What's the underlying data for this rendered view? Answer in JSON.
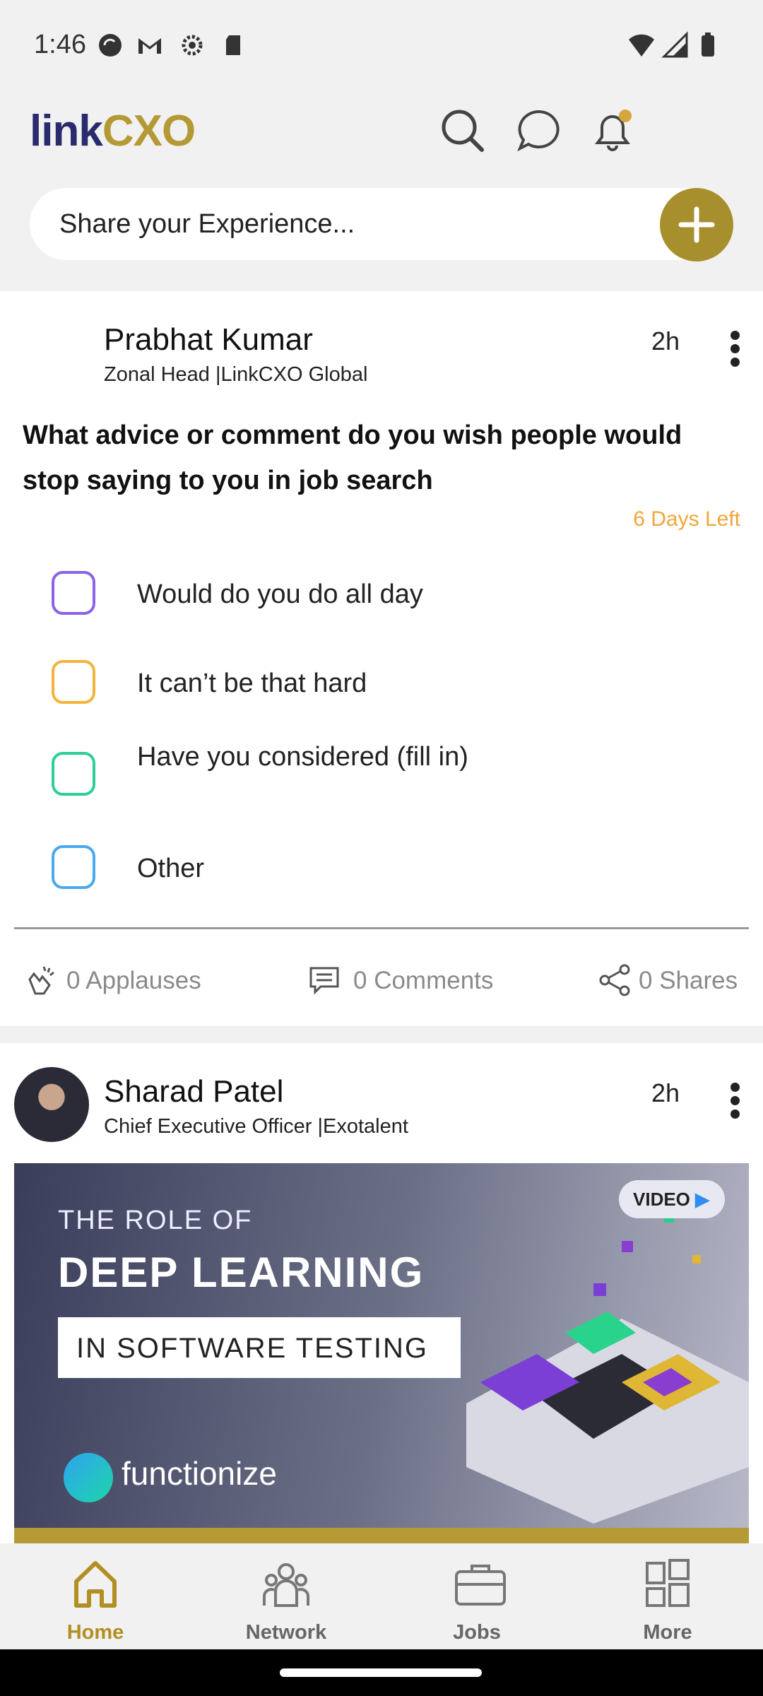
{
  "status_bar": {
    "time": "1:46"
  },
  "header": {
    "logo_part1": "link",
    "logo_part2": "CXO",
    "share_placeholder": "Share your Experience..."
  },
  "post1": {
    "author": "Prabhat Kumar",
    "subtitle": "Zonal Head |LinkCXO Global",
    "time": "2h",
    "question": "What advice or comment do you wish people would stop saying to you in job search",
    "days_left": "6 Days Left",
    "options": [
      {
        "label": "Would do you do all day",
        "color": "#8a63e8"
      },
      {
        "label": "It can’t be that hard",
        "color": "#f2b43a"
      },
      {
        "label": "Have you considered (fill in)",
        "color": "#2ecf97"
      },
      {
        "label": "Other",
        "color": "#4aa8ee"
      }
    ],
    "stats": {
      "applauses": "0 Applauses",
      "comments": "0 Comments",
      "shares": "0 Shares"
    }
  },
  "post2": {
    "author": "Sharad Patel",
    "subtitle": "Chief Executive Officer |Exotalent",
    "time": "2h",
    "banner": {
      "line1": "THE ROLE OF",
      "line2": "DEEP LEARNING",
      "line3": "IN SOFTWARE TESTING",
      "badge": "VIDEO",
      "brand": "functionize"
    }
  },
  "nav": [
    {
      "label": "Home",
      "active": true
    },
    {
      "label": "Network",
      "active": false
    },
    {
      "label": "Jobs",
      "active": false
    },
    {
      "label": "More",
      "active": false
    }
  ],
  "colors": {
    "accent": "#a88f2e",
    "active_nav": "#b28f22"
  }
}
